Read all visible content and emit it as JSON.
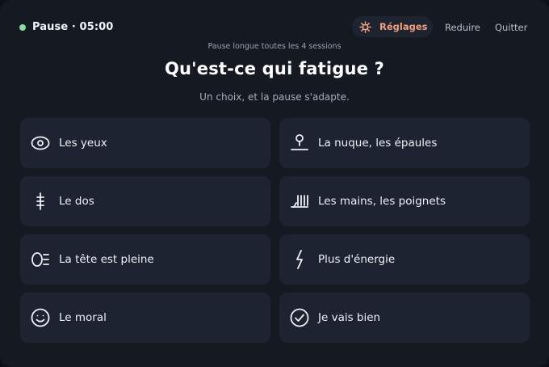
{
  "header": {
    "status_text": "Pause · 05:00",
    "settings_label": "Réglages",
    "settings_icon": "sun-gear-icon",
    "reduce_label": "Reduire",
    "quit_label": "Quitter"
  },
  "intro": {
    "hint": "Pause longue toutes les 4 sessions",
    "title": "Qu'est-ce qui fatigue ?",
    "subtitle": "Un choix, et la pause s'adapte."
  },
  "choices": [
    {
      "label": "Les yeux",
      "icon": "eye-icon"
    },
    {
      "label": "La nuque, les épaules",
      "icon": "neck-shoulders-icon"
    },
    {
      "label": "Le dos",
      "icon": "spine-icon"
    },
    {
      "label": "Les mains, les poignets",
      "icon": "hand-icon"
    },
    {
      "label": "La tête est pleine",
      "icon": "head-full-icon"
    },
    {
      "label": "Plus d'énergie",
      "icon": "lightning-icon"
    },
    {
      "label": "Le moral",
      "icon": "smile-icon"
    },
    {
      "label": "Je vais bien",
      "icon": "check-circle-icon"
    }
  ],
  "colors": {
    "background": "#141922",
    "card": "#1d2330",
    "accent": "#f0a07e",
    "status_dot": "#8fd9a4"
  }
}
